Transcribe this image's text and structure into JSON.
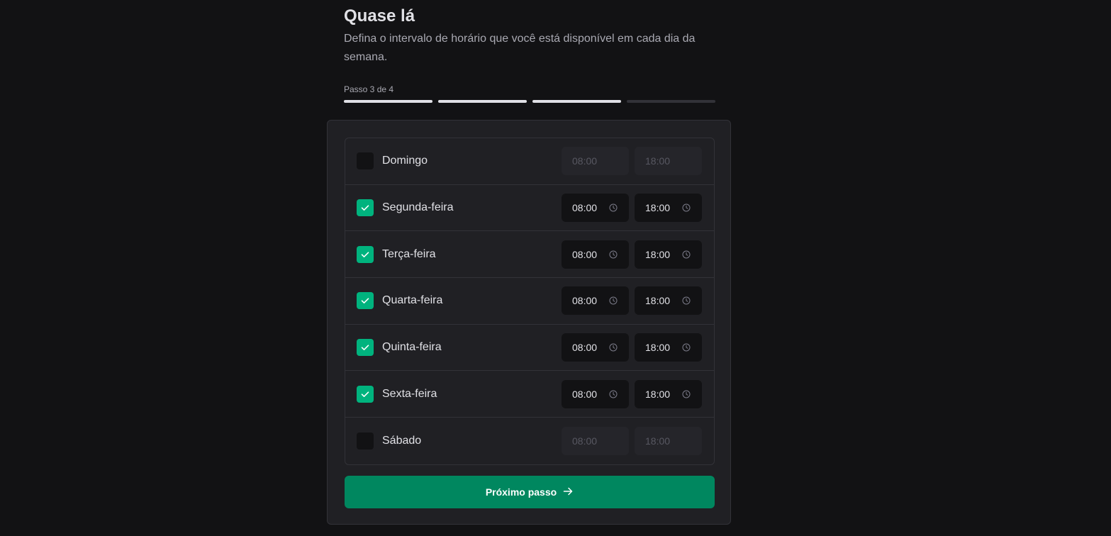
{
  "header": {
    "title": "Quase lá",
    "subtitle": "Defina o intervalo de horário que você está disponível em cada dia da semana."
  },
  "progress": {
    "label": "Passo 3 de 4",
    "current_step": 3,
    "total_steps": 4
  },
  "intervals": [
    {
      "day": "Domingo",
      "enabled": false,
      "start": "08:00",
      "end": "18:00"
    },
    {
      "day": "Segunda-feira",
      "enabled": true,
      "start": "08:00",
      "end": "18:00"
    },
    {
      "day": "Terça-feira",
      "enabled": true,
      "start": "08:00",
      "end": "18:00"
    },
    {
      "day": "Quarta-feira",
      "enabled": true,
      "start": "08:00",
      "end": "18:00"
    },
    {
      "day": "Quinta-feira",
      "enabled": true,
      "start": "08:00",
      "end": "18:00"
    },
    {
      "day": "Sexta-feira",
      "enabled": true,
      "start": "08:00",
      "end": "18:00"
    },
    {
      "day": "Sábado",
      "enabled": false,
      "start": "08:00",
      "end": "18:00"
    }
  ],
  "next_button": {
    "label": "Próximo passo",
    "icon": "arrow-right-icon"
  },
  "colors": {
    "background": "#121214",
    "card": "#202024",
    "accent": "#00875f",
    "checkbox_checked": "#00b37e"
  },
  "icons": {
    "checkbox": "check-icon",
    "time": "clock-icon"
  }
}
